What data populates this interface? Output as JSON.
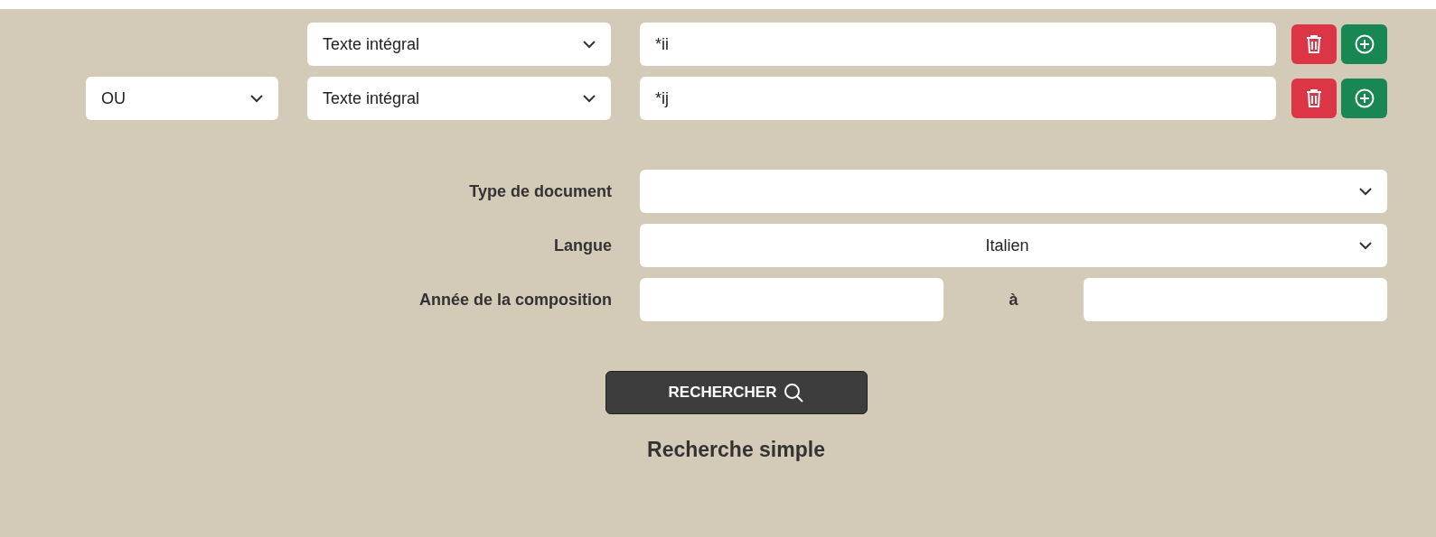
{
  "query_rows": [
    {
      "field": "Texte intégral",
      "value": "*ii"
    },
    {
      "operator": "OU",
      "field": "Texte intégral",
      "value": "*ij"
    }
  ],
  "filters": [
    {
      "kind": "select",
      "label": "Type de document"
    },
    {
      "kind": "select",
      "label": "Langue",
      "value": "Italien"
    },
    {
      "kind": "range",
      "label": "Année de la composition",
      "separator": "à"
    }
  ],
  "search_button": "RECHERCHER",
  "simple_search_link": "Recherche simple"
}
